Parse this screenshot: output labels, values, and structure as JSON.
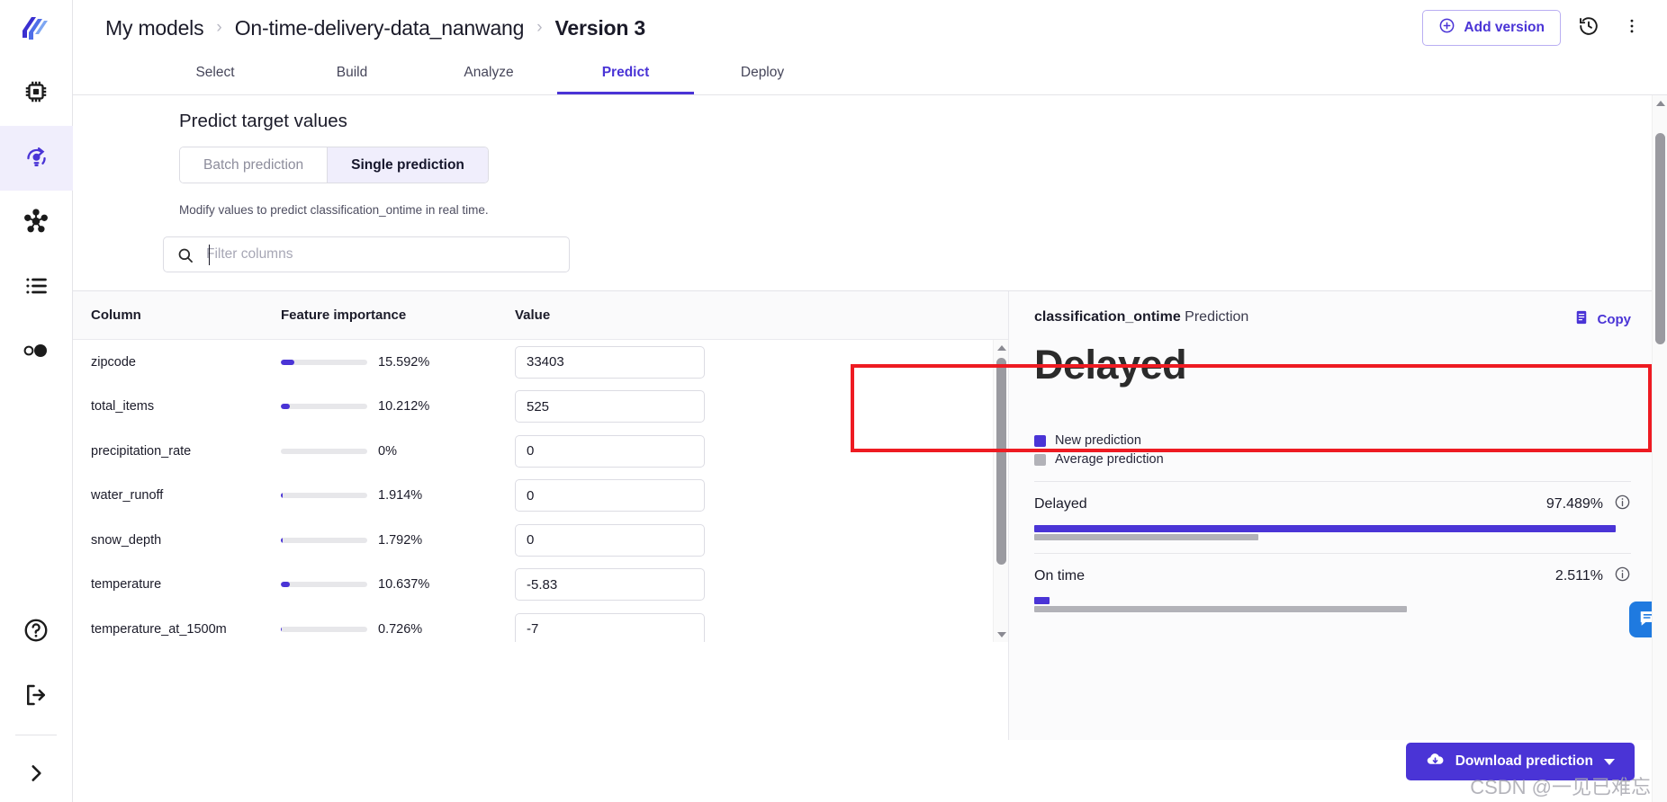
{
  "sidebar": {
    "items": [
      {
        "name": "logo",
        "icon": "app-logo-icon",
        "active": false
      },
      {
        "name": "datasets",
        "icon": "chip-icon",
        "active": false
      },
      {
        "name": "models",
        "icon": "predict-lightbulb-icon",
        "active": true
      },
      {
        "name": "connections",
        "icon": "hub-network-icon",
        "active": false
      },
      {
        "name": "jobs",
        "icon": "list-icon",
        "active": false
      },
      {
        "name": "clusters",
        "icon": "circles-icon",
        "active": false
      }
    ],
    "bottom": [
      {
        "name": "help",
        "icon": "question-circle-icon"
      },
      {
        "name": "logout",
        "icon": "logout-icon"
      },
      {
        "name": "expand",
        "icon": "chevron-right-icon"
      }
    ]
  },
  "header": {
    "breadcrumb": [
      {
        "label": "My models",
        "current": false
      },
      {
        "label": "On-time-delivery-data_nanwang",
        "current": false
      },
      {
        "label": "Version 3",
        "current": true
      }
    ],
    "separator": "›",
    "add_version_label": "Add version",
    "add_icon": "plus-circle-icon",
    "history_icon": "history-clock-icon",
    "more_icon": "more-vertical-icon"
  },
  "tabs": [
    {
      "label": "Select",
      "active": false
    },
    {
      "label": "Build",
      "active": false
    },
    {
      "label": "Analyze",
      "active": false
    },
    {
      "label": "Predict",
      "active": true
    },
    {
      "label": "Deploy",
      "active": false
    }
  ],
  "predict": {
    "section_title": "Predict target values",
    "segments": [
      {
        "label": "Batch prediction",
        "active": false
      },
      {
        "label": "Single prediction",
        "active": true
      }
    ],
    "hint": "Modify values to predict classification_ontime in real time.",
    "filter": {
      "placeholder": "Filter columns",
      "value": "",
      "icon": "search-icon"
    }
  },
  "table": {
    "headers": {
      "column": "Column",
      "importance": "Feature importance",
      "value": "Value"
    },
    "rows": [
      {
        "column": "zipcode",
        "importance_pct": 15.592,
        "importance_label": "15.592%",
        "value": "33403"
      },
      {
        "column": "total_items",
        "importance_pct": 10.212,
        "importance_label": "10.212%",
        "value": "525"
      },
      {
        "column": "precipitation_rate",
        "importance_pct": 0,
        "importance_label": "0%",
        "value": "0"
      },
      {
        "column": "water_runoff",
        "importance_pct": 1.914,
        "importance_label": "1.914%",
        "value": "0"
      },
      {
        "column": "snow_depth",
        "importance_pct": 1.792,
        "importance_label": "1.792%",
        "value": "0"
      },
      {
        "column": "temperature",
        "importance_pct": 10.637,
        "importance_label": "10.637%",
        "value": "-5.83"
      },
      {
        "column": "temperature_at_1500m",
        "importance_pct": 0.726,
        "importance_label": "0.726%",
        "value": "-7"
      }
    ]
  },
  "panel": {
    "target": "classification_ontime",
    "title_suffix": " Prediction",
    "copy_label": "Copy",
    "copy_icon": "copy-document-icon",
    "result": "Delayed",
    "legend": [
      {
        "label": "New prediction",
        "color": "#4a34d6"
      },
      {
        "label": "Average prediction",
        "color": "#b2b2b8"
      }
    ],
    "classes": [
      {
        "name": "Delayed",
        "pct_label": "97.489%",
        "new_pct": 97.489,
        "avg_pct": 37.5,
        "info_icon": "info-circle-icon",
        "highlighted": true
      },
      {
        "name": "On time",
        "pct_label": "2.511%",
        "new_pct": 2.511,
        "avg_pct": 62.5,
        "info_icon": "info-circle-icon",
        "highlighted": false
      }
    ],
    "download_label": "Download prediction",
    "download_icon": "cloud-download-icon"
  },
  "overlay": {
    "watermark": "CSDN @一见已难忘",
    "chat_icon": "chat-bubble-icon",
    "highlight_color": "#ee1b22"
  },
  "colors": {
    "accent": "#4a34d6",
    "accent_light": "#f0eefc",
    "grey_bar": "#b2b2b8"
  }
}
